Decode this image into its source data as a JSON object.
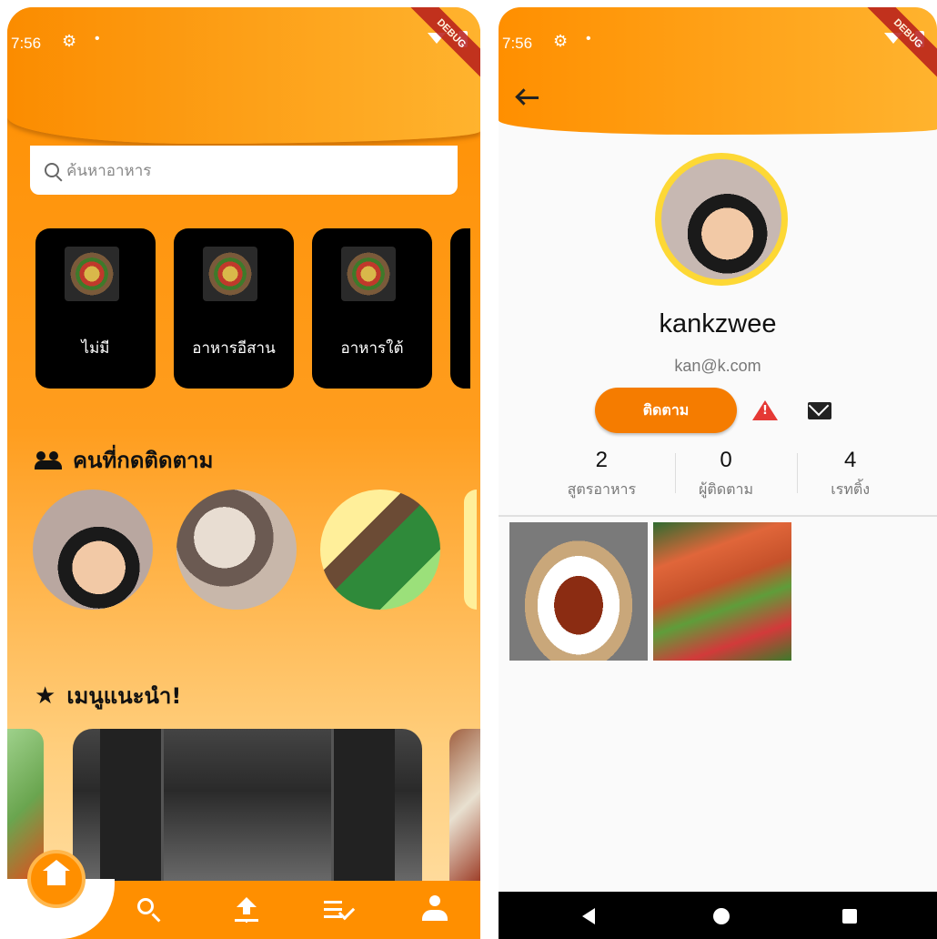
{
  "left_screen": {
    "status_bar": {
      "time": "7:56",
      "debug_banner": "DEBUG"
    },
    "search": {
      "placeholder": "ค้นหาอาหาร"
    },
    "categories": [
      {
        "label": "ไม่มี"
      },
      {
        "label": "อาหารอีสาน"
      },
      {
        "label": "อาหารใต้"
      }
    ],
    "following_section": {
      "title": "คนที่กดติดตาม",
      "icon": "people-icon"
    },
    "recommended_section": {
      "title": "เมนูแนะนำ!",
      "icon": "star-icon"
    },
    "bottom_nav": {
      "items": [
        "home-icon",
        "search-icon",
        "upload-icon",
        "checklist-icon",
        "person-icon"
      ],
      "active": "home-icon",
      "accent": "#ff8f00"
    }
  },
  "right_screen": {
    "status_bar": {
      "time": "7:56",
      "debug_banner": "DEBUG"
    },
    "profile": {
      "username": "kankzwee",
      "email": "kan@k.com",
      "follow_label": "ติดตาม"
    },
    "stats": [
      {
        "value": "2",
        "label": "สูตรอาหาร"
      },
      {
        "value": "0",
        "label": "ผู้ติดตาม"
      },
      {
        "value": "4",
        "label": "เรทติ้ง"
      }
    ],
    "posts": [
      "post-sweet-pork",
      "post-salmon-salad"
    ],
    "colors": {
      "accent": "#f57c00",
      "avatar_ring": "#fdd835",
      "report": "#e53935"
    }
  }
}
